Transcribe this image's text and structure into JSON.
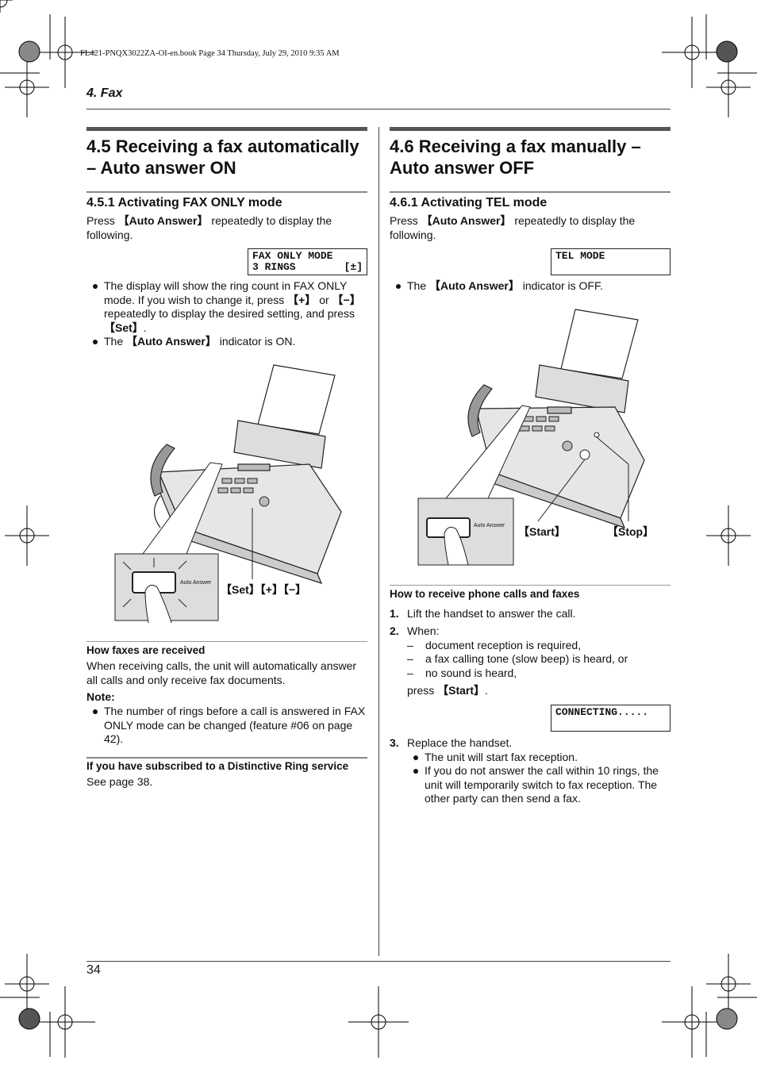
{
  "book_header": "FL421-PNQX3022ZA-OI-en.book  Page 34  Thursday, July 29, 2010  9:35 AM",
  "chapter": "4. Fax",
  "page_number": "34",
  "left": {
    "title_line1": "4.5 Receiving a fax automatically",
    "title_line2": "– Auto answer ON",
    "sub_title": "4.5.1 Activating FAX ONLY mode",
    "intro_pre": "Press ",
    "intro_key": "【Auto Answer】",
    "intro_post": " repeatedly to display the following.",
    "lcd_line1": "FAX ONLY MODE",
    "lcd_line2_left": "3 RINGS",
    "lcd_line2_right": "[±]",
    "bullet1": {
      "a": "The display will show the ring count in FAX ONLY mode. If you wish to change it, press ",
      "k1": "【+】",
      "b": " or ",
      "k2": "【−】",
      "c": " repeatedly to display the desired setting, and press ",
      "k3": "【Set】",
      "d": "."
    },
    "bullet2": {
      "a": "The ",
      "k": "【Auto Answer】",
      "b": " indicator is ON."
    },
    "illus_button_label": "Auto Answer",
    "illus_callout": "【Set】【+】【−】",
    "how_title": "How faxes are received",
    "how_text": "When receiving calls, the unit will automatically answer all calls and only receive fax documents.",
    "note_title": "Note:",
    "note_bullet": "The number of rings before a call is answered in FAX ONLY mode can be changed (feature #06 on page 42).",
    "ring_title": "If you have subscribed to a Distinctive Ring service",
    "ring_text": "See page 38."
  },
  "right": {
    "title_line1": "4.6 Receiving a fax manually –",
    "title_line2": "Auto answer OFF",
    "sub_title": "4.6.1 Activating TEL mode",
    "intro_pre": "Press ",
    "intro_key": "【Auto Answer】",
    "intro_post": " repeatedly to display the following.",
    "lcd": "TEL MODE",
    "bullet1": {
      "a": "The ",
      "k": "【Auto Answer】",
      "b": " indicator is OFF."
    },
    "illus_button_label": "Auto Answer",
    "callout_start": "【Start】",
    "callout_stop": "【Stop】",
    "how_title": "How to receive phone calls and faxes",
    "steps": [
      {
        "num": "1.",
        "text": "Lift the handset to answer the call."
      },
      {
        "num": "2.",
        "text": "When:"
      }
    ],
    "dashes": [
      "document reception is required,",
      "a fax calling tone (slow beep) is heard, or",
      "no sound is heard,"
    ],
    "press_pre": "press ",
    "press_key": "【Start】",
    "press_post": ".",
    "lcd2": "CONNECTING.....",
    "step3_num": "3.",
    "step3_text": "Replace the handset.",
    "step3_bullets": [
      "The unit will start fax reception.",
      "If you do not answer the call within 10 rings, the unit will temporarily switch to fax reception. The other party can then send a fax."
    ]
  }
}
